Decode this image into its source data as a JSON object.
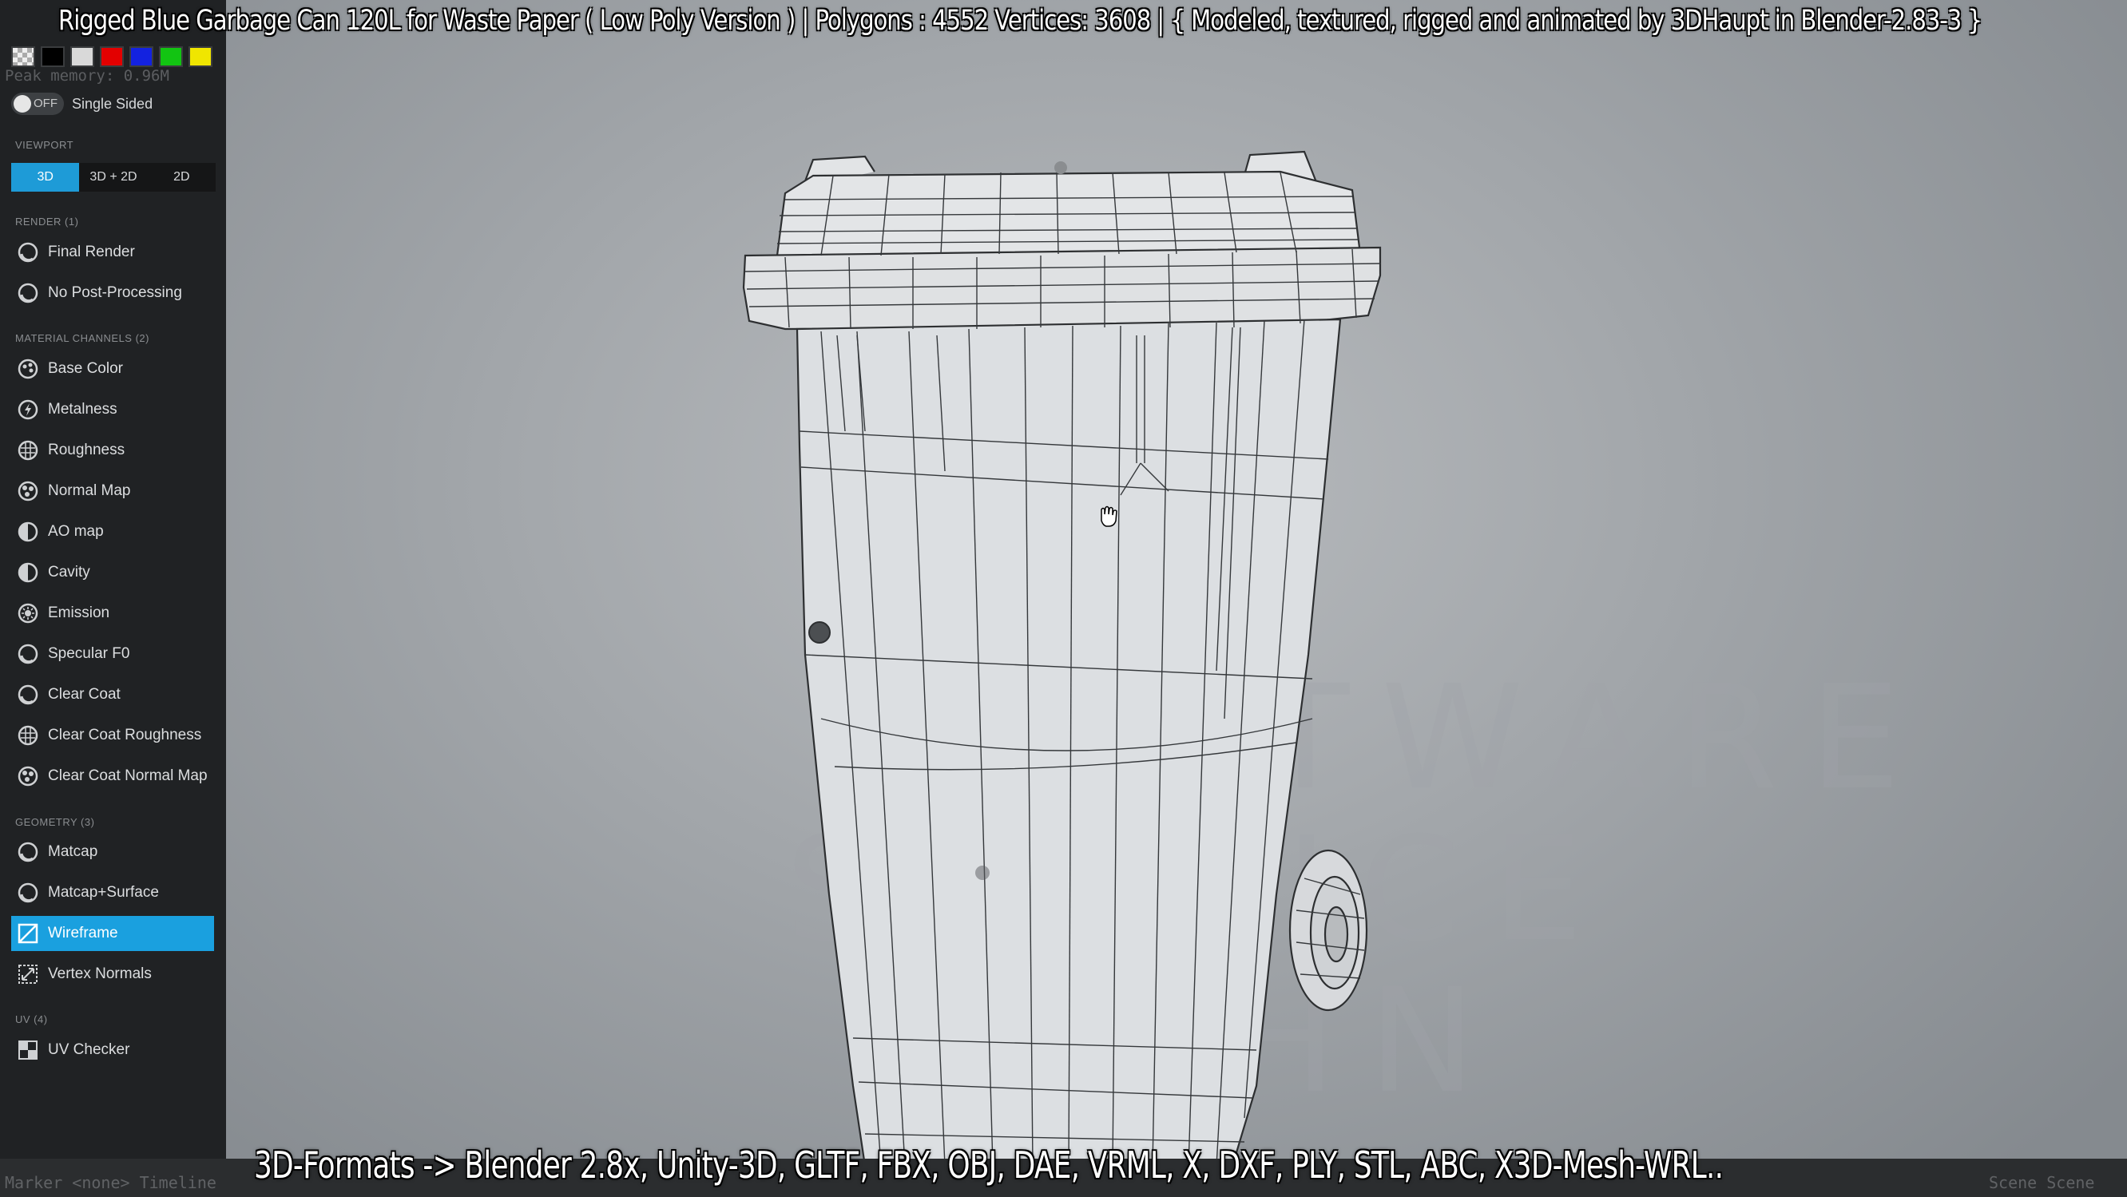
{
  "title_overlay": "Rigged Blue Garbage Can 120L for Waste Paper ( Low Poly Version ) |  Polygons : 4552  Vertices: 3608   |   { Modeled, textured, rigged and animated by 3DHaupt in Blender-2.83-3 }",
  "formats_overlay": "3D-Formats -> Blender 2.8x, Unity-3D, GLTF, FBX, OBJ, DAE, VRML, X, DXF, PLY, STL, ABC, X3D-Mesh-WRL..",
  "swatch_colors": [
    "checker",
    "#000000",
    "#d9d9d9",
    "#e30000",
    "#1322e0",
    "#12c412",
    "#f0e600"
  ],
  "single_sided": {
    "state": "OFF",
    "label": "Single Sided"
  },
  "sections": {
    "viewport": "VIEWPORT",
    "render": "RENDER (1)",
    "material": "MATERIAL CHANNELS (2)",
    "geometry": "GEOMETRY (3)",
    "uv": "UV (4)"
  },
  "viewport_tabs": [
    {
      "label": "3D",
      "active": true
    },
    {
      "label": "3D + 2D",
      "active": false
    },
    {
      "label": "2D",
      "active": false
    }
  ],
  "render_items": [
    {
      "label": "Final Render",
      "icon": "circle-icon"
    },
    {
      "label": "No Post-Processing",
      "icon": "circle-icon"
    }
  ],
  "material_items": [
    {
      "label": "Base Color",
      "icon": "palette-icon"
    },
    {
      "label": "Metalness",
      "icon": "bolt-icon"
    },
    {
      "label": "Roughness",
      "icon": "grid-circle-icon"
    },
    {
      "label": "Normal Map",
      "icon": "bumps-icon"
    },
    {
      "label": "AO map",
      "icon": "half-circle-icon"
    },
    {
      "label": "Cavity",
      "icon": "half-circle-icon"
    },
    {
      "label": "Emission",
      "icon": "sun-icon"
    },
    {
      "label": "Specular F0",
      "icon": "circle-icon"
    },
    {
      "label": "Clear Coat",
      "icon": "circle-icon"
    },
    {
      "label": "Clear Coat Roughness",
      "icon": "grid-circle-icon"
    },
    {
      "label": "Clear Coat Normal Map",
      "icon": "bumps-icon"
    }
  ],
  "geometry_items": [
    {
      "label": "Matcap",
      "icon": "circle-icon",
      "active": false
    },
    {
      "label": "Matcap+Surface",
      "icon": "circle-icon",
      "active": false
    },
    {
      "label": "Wireframe",
      "icon": "wireframe-icon",
      "active": true
    },
    {
      "label": "Vertex Normals",
      "icon": "arrows-icon",
      "active": false
    }
  ],
  "uv_items": [
    {
      "label": "UV Checker",
      "icon": "checker-icon"
    }
  ],
  "faint_text": {
    "memory": "Peak memory: 0.96M",
    "bottom_left": "Marker <none>    Timeline",
    "bottom_right": "Scene  Scene"
  },
  "watermark": [
    "SOFTWARE",
    "SERVICE",
    "JOHN"
  ]
}
